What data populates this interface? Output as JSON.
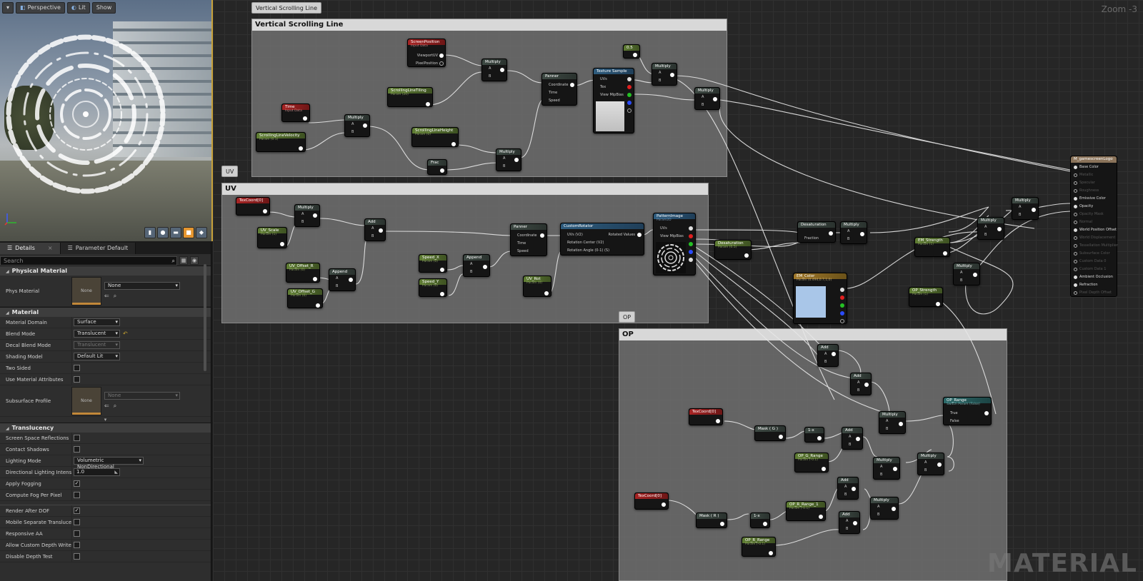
{
  "viewport": {
    "toolbar": {
      "menu_icon": "chevron-down-icon",
      "perspective": "Perspective",
      "lit": "Lit",
      "show": "Show"
    }
  },
  "details": {
    "tabs": [
      {
        "label": "Details"
      },
      {
        "label": "Parameter Default"
      }
    ],
    "search_placeholder": "Search",
    "physical_material": {
      "header": "Physical Material",
      "phys_material_label": "Phys Material",
      "phys_material_value": "None",
      "thumb_text": "None"
    },
    "material": {
      "header": "Material",
      "rows": [
        {
          "label": "Material Domain",
          "value": "Surface"
        },
        {
          "label": "Blend Mode",
          "value": "Translucent"
        },
        {
          "label": "Decal Blend Mode",
          "value": "Translucent"
        },
        {
          "label": "Shading Model",
          "value": "Default Lit"
        },
        {
          "label": "Two Sided"
        },
        {
          "label": "Use Material Attributes"
        }
      ],
      "subsurface_label": "Subsurface Profile",
      "subsurface_value": "None",
      "subsurface_thumb": "None"
    },
    "translucency": {
      "header": "Translucency",
      "rows": [
        {
          "label": "Screen Space Reflections",
          "checked": false
        },
        {
          "label": "Contact Shadows",
          "checked": false
        },
        {
          "label": "Lighting Mode",
          "value": "Volumetric NonDirectional"
        },
        {
          "label": "Directional Lighting Intensit",
          "value": "1.0"
        },
        {
          "label": "Apply Fogging",
          "checked": true
        },
        {
          "label": "Compute Fog Per Pixel",
          "checked": false
        },
        {
          "label": "Render After DOF",
          "checked": true
        },
        {
          "label": "Mobile Separate Translucer",
          "checked": false
        },
        {
          "label": "Responsive AA",
          "checked": false
        },
        {
          "label": "Allow Custom Depth Writes",
          "checked": false
        },
        {
          "label": "Disable Depth Test",
          "checked": false
        }
      ]
    }
  },
  "graph": {
    "zoom": "Zoom -3",
    "watermark": "MATERIAL",
    "comments": {
      "vsl": {
        "bubble": "Vertical Scrolling Line",
        "title": "Vertical Scrolling Line"
      },
      "uv": {
        "bubble": "UV",
        "title": "UV"
      },
      "op": {
        "bubble": "OP",
        "title": "OP"
      }
    },
    "nodes": {
      "screenpos": {
        "title": "ScreenPosition",
        "sub": "Input Data",
        "pins": [
          "ViewportUV",
          "PixelPosition"
        ]
      },
      "time": {
        "title": "Time",
        "sub": "Input Data"
      },
      "slv": {
        "title": "ScrollingLineVelocity",
        "sub": "Param (0.1)"
      },
      "mul1": {
        "title": "Multiply",
        "a": "A",
        "b": "B"
      },
      "slt": {
        "title": "ScrollingLineTiling",
        "sub": "Param (20)"
      },
      "mul2": {
        "title": "Multiply",
        "a": "A",
        "b": "B"
      },
      "slh": {
        "title": "ScrollingLineHeight",
        "sub": "Param (0)"
      },
      "frac": {
        "title": "Frac"
      },
      "mul3": {
        "title": "Multiply",
        "a": "A",
        "b": "B"
      },
      "panner1": {
        "title": "Panner",
        "pins": [
          "Coordinate",
          "Time",
          "Speed"
        ]
      },
      "texsample": {
        "title": "Texture Sample",
        "pins": [
          "UVs",
          "Tex",
          "View MipBias"
        ]
      },
      "c05": {
        "title": "0.5"
      },
      "mul4": {
        "title": "Multiply",
        "a": "A",
        "b": "B"
      },
      "mul5": {
        "title": "Multiply",
        "a": "A",
        "b": "B"
      },
      "texcoord1": {
        "title": "TexCoord[0]"
      },
      "uvscale": {
        "title": "UV_Scale",
        "sub": "Param (1)"
      },
      "mul6": {
        "title": "Multiply",
        "a": "A",
        "b": "B"
      },
      "add1": {
        "title": "Add",
        "a": "A",
        "b": "B"
      },
      "uvoffr": {
        "title": "UV_Offset_R",
        "sub": "Param (0)"
      },
      "uvoffg": {
        "title": "UV_Offset_G",
        "sub": "Param (0)"
      },
      "append1": {
        "title": "Append",
        "a": "A",
        "b": "B"
      },
      "speedx": {
        "title": "Speed_X",
        "sub": "Param (0)"
      },
      "speedy": {
        "title": "Speed_Y",
        "sub": "Param (0)"
      },
      "append2": {
        "title": "Append",
        "a": "A",
        "b": "B"
      },
      "panner2": {
        "title": "Panner",
        "pins": [
          "Coordinate",
          "Time",
          "Speed"
        ]
      },
      "uvrot": {
        "title": "UV_Rot",
        "sub": "Param (0)"
      },
      "customrot": {
        "title": "CustomRotator",
        "pins": [
          "UVs (V2)",
          "Rotation Center (V2)",
          "Rotation Angle (0-1) (S)"
        ],
        "out": "Rotated Values"
      },
      "patternimage": {
        "title": "PatternImage",
        "sub": "Param2D",
        "pins": [
          "UVs",
          "View MipBias"
        ]
      },
      "desat1": {
        "title": "Desaturation",
        "pin": "Fraction"
      },
      "desat2": {
        "title": "Desaturation",
        "sub": "Param (0.5)"
      },
      "mul7": {
        "title": "Multiply",
        "a": "A",
        "b": "B"
      },
      "emcolor": {
        "title": "EM_Color",
        "sub": "Param (0.494,0.7,1,0)"
      },
      "emstrength": {
        "title": "EM_Strength",
        "sub": "Param (1)"
      },
      "mul8": {
        "title": "Multiply",
        "a": "A",
        "b": "B"
      },
      "mul9": {
        "title": "Multiply",
        "a": "A",
        "b": "B"
      },
      "opstrength": {
        "title": "OP_Strength",
        "sub": "Param (1)"
      },
      "mul10": {
        "title": "Multiply",
        "a": "A",
        "b": "B"
      },
      "add2": {
        "title": "Add",
        "a": "A",
        "b": "B"
      },
      "add3": {
        "title": "Add",
        "a": "A",
        "b": "B"
      },
      "oprange": {
        "title": "OP_Range",
        "sub": "Switch Param (False)",
        "pins": [
          "True",
          "False"
        ]
      },
      "texcoord2": {
        "title": "TexCoord[0]"
      },
      "maskg": {
        "title": "Mask ( G )"
      },
      "oneminus1": {
        "title": "1-x"
      },
      "add4": {
        "title": "Add",
        "a": "A",
        "b": "B"
      },
      "mul11": {
        "title": "Multiply",
        "a": "A",
        "b": "B"
      },
      "opgrange": {
        "title": "OP_G_Range",
        "sub": "Param (-0.1)"
      },
      "mul12": {
        "title": "Multiply",
        "a": "A",
        "b": "B"
      },
      "mul13": {
        "title": "Multiply",
        "a": "A",
        "b": "B"
      },
      "texcoord3": {
        "title": "TexCoord[0]"
      },
      "maskr": {
        "title": "Mask ( R )"
      },
      "oneminus2": {
        "title": "1-x"
      },
      "oprrange1": {
        "title": "OP_R_Range_1",
        "sub": "Param (-0.1)"
      },
      "add5": {
        "title": "Add",
        "a": "A",
        "b": "B"
      },
      "mul14": {
        "title": "Multiply",
        "a": "A",
        "b": "B"
      },
      "add6": {
        "title": "Add",
        "a": "A",
        "b": "B"
      },
      "oprrange": {
        "title": "OP_R_Range",
        "sub": "Param (-0.1)"
      }
    },
    "main_node": {
      "title": "M_gamescreenLogo",
      "inputs": [
        {
          "label": "Base Color",
          "on": true
        },
        {
          "label": "Metallic",
          "on": false
        },
        {
          "label": "Specular",
          "on": false
        },
        {
          "label": "Roughness",
          "on": false
        },
        {
          "label": "Emissive Color",
          "on": true
        },
        {
          "label": "Opacity",
          "on": true
        },
        {
          "label": "Opacity Mask",
          "on": false
        },
        {
          "label": "Normal",
          "on": false
        },
        {
          "label": "World Position Offset",
          "on": true
        },
        {
          "label": "World Displacement",
          "on": false
        },
        {
          "label": "Tessellation Multiplier",
          "on": false
        },
        {
          "label": "Subsurface Color",
          "on": false
        },
        {
          "label": "Custom Data 0",
          "on": false
        },
        {
          "label": "Custom Data 1",
          "on": false
        },
        {
          "label": "Ambient Occlusion",
          "on": true
        },
        {
          "label": "Refraction",
          "on": true
        },
        {
          "label": "Pixel Depth Offset",
          "on": false
        }
      ]
    },
    "colors": {
      "em_color_preview": "#a9c6e8",
      "texture_preview": "#cfcfcf"
    }
  }
}
